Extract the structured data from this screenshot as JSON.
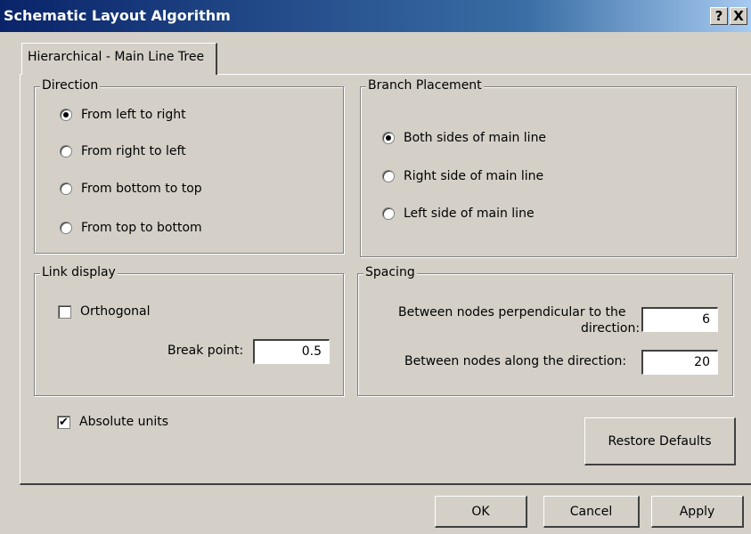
{
  "window": {
    "title": "Schematic Layout Algorithm",
    "help_glyph": "?",
    "close_glyph": "X"
  },
  "tabs": [
    {
      "label": "Hierarchical - Main Line Tree"
    }
  ],
  "direction": {
    "legend": "Direction",
    "options": [
      {
        "label": "From left to right",
        "selected": true
      },
      {
        "label": "From right to left",
        "selected": false
      },
      {
        "label": "From bottom to top",
        "selected": false
      },
      {
        "label": "From top to bottom",
        "selected": false
      }
    ]
  },
  "branch": {
    "legend": "Branch Placement",
    "options": [
      {
        "label": "Both sides of main line",
        "selected": true
      },
      {
        "label": "Right side of main line",
        "selected": false
      },
      {
        "label": "Left side of main line",
        "selected": false
      }
    ]
  },
  "link": {
    "legend": "Link display",
    "orthogonal_label": "Orthogonal",
    "orthogonal_checked": false,
    "break_label": "Break point:",
    "break_value": "0.5"
  },
  "spacing": {
    "legend": "Spacing",
    "perp_label_line1": "Between nodes perpendicular to the",
    "perp_label_line2": "direction:",
    "perp_value": "6",
    "along_label": "Between nodes along the direction:",
    "along_value": "20"
  },
  "absolute_units": {
    "label": "Absolute units",
    "checked": true
  },
  "buttons": {
    "restore": "Restore Defaults",
    "ok": "OK",
    "cancel": "Cancel",
    "apply": "Apply"
  }
}
